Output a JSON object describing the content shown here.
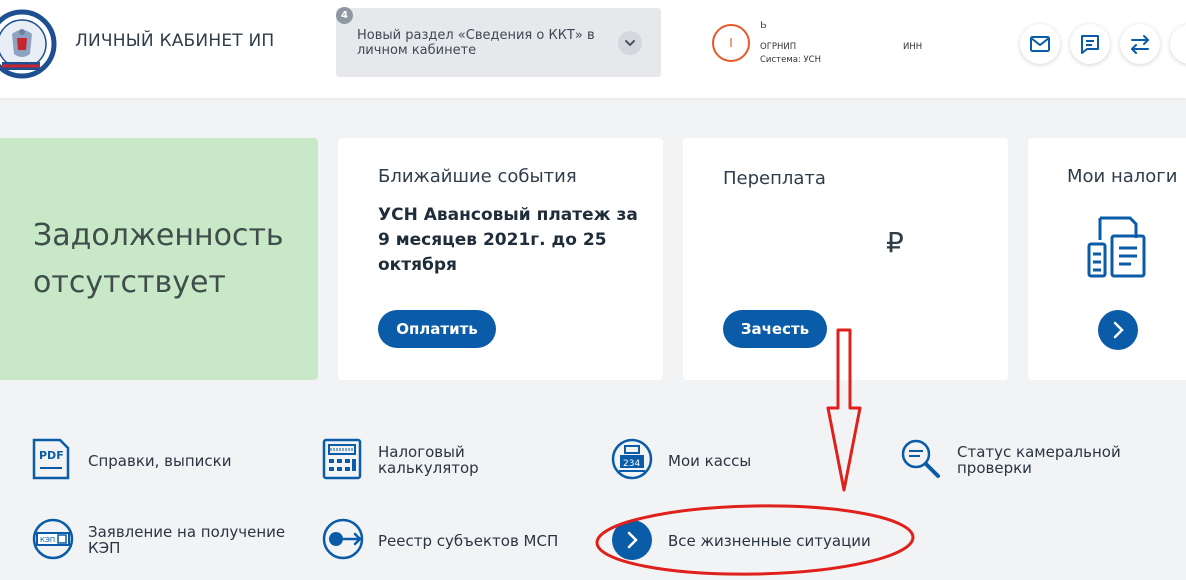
{
  "header": {
    "brand": "ЛИЧНЫЙ КАБИНЕТ ИП",
    "notice": {
      "badge": "4",
      "text": "Новый раздел «Сведения о ККТ» в личном кабинете"
    },
    "user": {
      "initial": "I",
      "name": "Ь",
      "ogrnip_label": "ОГРНИП",
      "inn_label": "ИНН",
      "system": "Система: УСН"
    },
    "icons": [
      "mail-icon",
      "chat-icon",
      "switch-icon"
    ]
  },
  "cards": {
    "debt": {
      "text": "Задолженность отсутствует"
    },
    "events": {
      "title": "Ближайшие события",
      "desc": "УСН Авансовый платеж за 9 месяцев 2021г. до 25 октября",
      "button": "Оплатить"
    },
    "overpay": {
      "title": "Переплата",
      "currency": "₽",
      "button": "Зачесть"
    },
    "taxes": {
      "title": "Мои налоги"
    }
  },
  "links": {
    "certs": "Справки, выписки",
    "calc": "Налоговый калькулятор",
    "kassy": "Мои кассы",
    "status": "Статус камеральной проверки",
    "kep": "Заявление на получение КЭП",
    "msp": "Реестр субъектов МСП",
    "all": "Все жизненные ситуации"
  },
  "icon_text": {
    "pdf": "PDF",
    "kassa": "234",
    "kep": "КЭП"
  },
  "colors": {
    "accent": "#0a5ba8",
    "debt_bg": "#c8e8c8",
    "annotation": "#e0201a"
  }
}
